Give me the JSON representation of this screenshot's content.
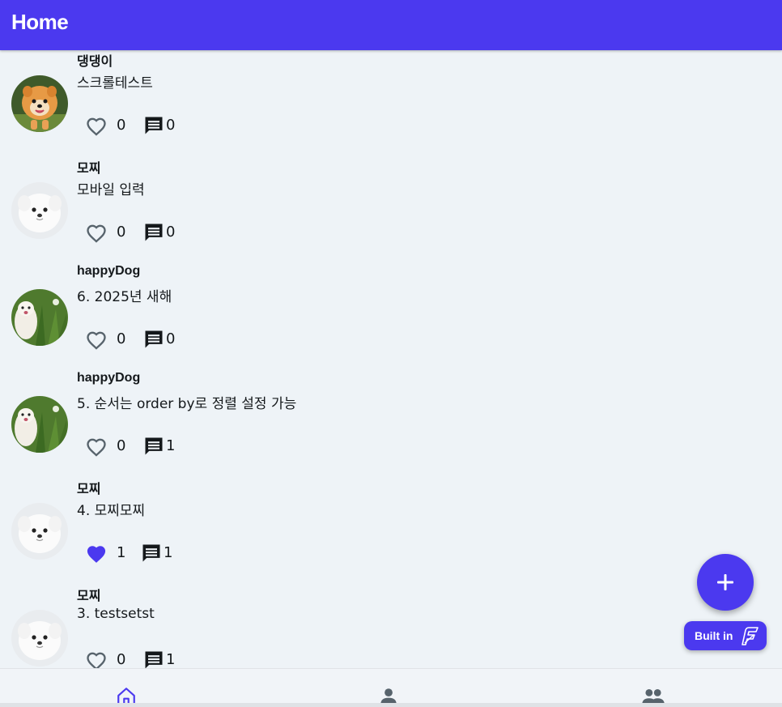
{
  "app": {
    "title": "Home",
    "accent": "#4b39ef",
    "background": "#eef3f7"
  },
  "posts": [
    {
      "author": "댕댕이",
      "content": "스크롤테스트",
      "likes": "0",
      "liked": false,
      "comments": "0",
      "avatar": "orange-pomeranian"
    },
    {
      "author": "모찌",
      "content": "모바일 입력",
      "likes": "0",
      "liked": false,
      "comments": "0",
      "avatar": "white-puppy"
    },
    {
      "author": "happyDog",
      "content": "6. 2025년 새해",
      "likes": "0",
      "liked": false,
      "comments": "0",
      "avatar": "dog-in-grass"
    },
    {
      "author": "happyDog",
      "content": "5. 순서는 order by로 정렬 설정 가능",
      "likes": "0",
      "liked": false,
      "comments": "1",
      "avatar": "dog-in-grass"
    },
    {
      "author": "모찌",
      "content": "4. 모찌모찌",
      "likes": "1",
      "liked": true,
      "comments": "1",
      "avatar": "white-puppy"
    },
    {
      "author": "모찌",
      "content": "3. testsetst",
      "likes": "0",
      "liked": false,
      "comments": "1",
      "avatar": "white-puppy"
    }
  ],
  "fab": {
    "icon": "plus-icon"
  },
  "badge": {
    "label": "Built in",
    "icon": "flutterflow-logo-icon"
  },
  "nav": [
    {
      "name": "home",
      "icon": "home-icon",
      "active": true
    },
    {
      "name": "profile",
      "icon": "person-icon",
      "active": false
    },
    {
      "name": "friends",
      "icon": "people-icon",
      "active": false
    }
  ]
}
